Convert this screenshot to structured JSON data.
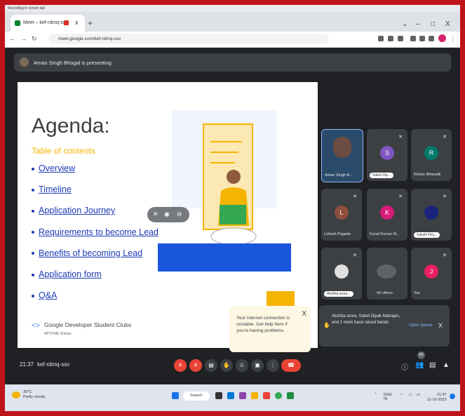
{
  "window": {
    "title_strip": "Recording in screen tab",
    "controls": [
      "⌄",
      "–",
      "□",
      "X"
    ]
  },
  "tab": {
    "title": "Meet – kef-rdmq-ssv",
    "close": "x",
    "new_tab": "+"
  },
  "address_bar": {
    "url": "meet.google.com/kef-rdmq-ssv"
  },
  "meet": {
    "presenting_text": "Aman Singh Bhogal is presenting",
    "slide": {
      "title": "Agenda:",
      "subtitle": "Table of contents",
      "items": [
        "Overview",
        "Timeline",
        "Application Journey",
        "Requirements to become Lead",
        "Benefits of becoming Lead",
        "Application form",
        "Q&A"
      ],
      "org_name": "Google Developer Student Clubs",
      "org_sub": "MPSTME Shirpur"
    },
    "participants": [
      {
        "name": "Aman Singh B...",
        "initial": "",
        "color": "#2a4a6a"
      },
      {
        "name": "Saket Dip...",
        "initial": "S",
        "color": "#7e57c2"
      },
      {
        "name": "Rohan Bhiwadk",
        "initial": "R",
        "color": "#00796b"
      },
      {
        "name": "Lokesh Pagade",
        "initial": "L",
        "color": "#8d4e3a"
      },
      {
        "name": "Kunal Kumar M...",
        "initial": "K",
        "color": "#d81b7a"
      },
      {
        "name": "Sakshi Dey...",
        "initial": "",
        "color": "#1a237e"
      },
      {
        "name": "Akshita arora...",
        "initial": "",
        "color": "#e0e0e0"
      },
      {
        "name": "43 others",
        "initial": "",
        "color": "#5f6368"
      },
      {
        "name": "You",
        "initial": "J",
        "color": "#e91e63"
      }
    ],
    "tooltip": {
      "text": "Your internet connection is unstable. Get help here if you're having problems.",
      "close": "X"
    },
    "notification": {
      "text": "Akshita arora, Saket Dipak Mahajan, and 2 more have raised hands",
      "action": "Open queue",
      "close": "X"
    },
    "meeting_time": "21:37",
    "meeting_code": "kef-rdmq-ssv",
    "people_count": "53"
  },
  "taskbar": {
    "temperature": "30°C",
    "weather": "Partly cloudy",
    "search": "Search",
    "lang": "ENG",
    "region": "IN",
    "clock_time": "21:37",
    "clock_date": "11-10-2023"
  }
}
